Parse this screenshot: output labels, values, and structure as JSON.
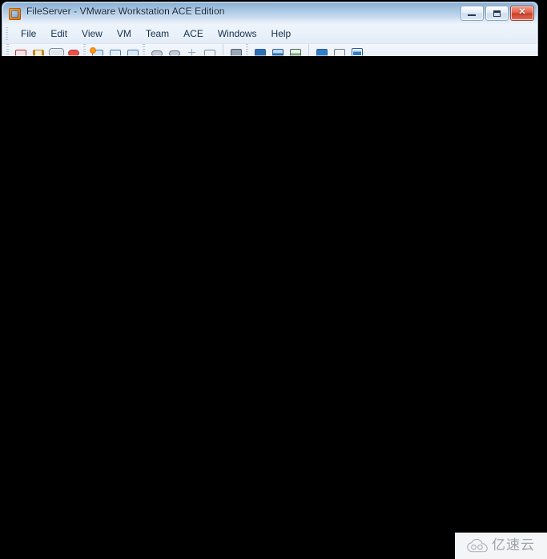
{
  "window": {
    "title": "FileServer - VMware Workstation ACE Edition",
    "app_icon": "vmware-workstation-icon",
    "controls": [
      {
        "name": "minimize",
        "glyph": "minimize-icon",
        "label": "Minimize"
      },
      {
        "name": "maximize",
        "glyph": "maximize-icon",
        "label": "Maximize"
      },
      {
        "name": "close",
        "glyph": "close-icon",
        "label": "✕"
      }
    ],
    "close_button_color": "#ca3f28",
    "title_bar_color": "#8fb3d6"
  },
  "menu": {
    "items": [
      {
        "label": "File"
      },
      {
        "label": "Edit"
      },
      {
        "label": "View"
      },
      {
        "label": "VM"
      },
      {
        "label": "Team"
      },
      {
        "label": "ACE"
      },
      {
        "label": "Windows"
      },
      {
        "label": "Help"
      }
    ]
  },
  "toolbar": {
    "note": "clipped - only top edge of icons visible",
    "groups": [
      {
        "name": "power-group",
        "icons": [
          {
            "name": "power-off-icon",
            "class": "pwr-red"
          },
          {
            "name": "suspend-icon",
            "class": "pwr-pause"
          },
          {
            "name": "power-on-icon",
            "class": "pwr-play"
          },
          {
            "name": "reset-icon",
            "class": "pwr-reset"
          }
        ]
      },
      {
        "name": "snapshot-group",
        "icons": [
          {
            "name": "take-snapshot-icon",
            "class": "snap-new"
          },
          {
            "name": "revert-snapshot-icon",
            "class": "snap-rev"
          },
          {
            "name": "snapshot-manager-icon",
            "class": "snap-mgr"
          }
        ]
      },
      {
        "name": "device-group",
        "icons": [
          {
            "name": "disk-icon",
            "class": "disk"
          },
          {
            "name": "disk-alt-icon",
            "class": "disk2"
          },
          {
            "name": "settings-star-icon",
            "class": "star"
          },
          {
            "name": "list-view-icon",
            "class": "list"
          }
        ]
      },
      {
        "name": "display-group",
        "icons": [
          {
            "name": "fullscreen-icon",
            "class": "full"
          }
        ]
      },
      {
        "name": "view-mode-group",
        "icons": [
          {
            "name": "quick-switch-icon",
            "class": "view1"
          },
          {
            "name": "unity-mode-icon",
            "class": "view2"
          },
          {
            "name": "multiple-monitors-icon",
            "class": "view3"
          }
        ]
      },
      {
        "name": "pane-group",
        "icons": [
          {
            "name": "sidebar-pane-icon",
            "class": "pane1"
          },
          {
            "name": "thumbnail-pane-icon",
            "class": "pane2"
          },
          {
            "name": "console-view-icon",
            "class": "pane3"
          }
        ]
      }
    ]
  },
  "console": {
    "name": "vm-console-screen",
    "state": "blank",
    "background_color": "#000000"
  },
  "watermark": {
    "text": "亿速云",
    "icon": "cloud-icon",
    "text_color": "#9ea4ac",
    "background_color": "#f4f5f7"
  }
}
